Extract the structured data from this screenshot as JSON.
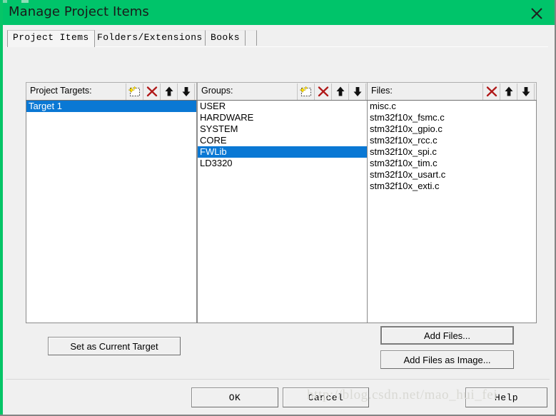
{
  "window": {
    "title": "Manage Project Items",
    "close_icon": "close-icon",
    "titlebar_color": "#00c46a",
    "accent_selection_color": "#0a78d4",
    "background_color": "#f0f0f0"
  },
  "tabs": [
    {
      "label": "Project Items",
      "active": true
    },
    {
      "label": "Folders/Extensions",
      "active": false
    },
    {
      "label": "Books",
      "active": false
    }
  ],
  "columns": {
    "project_targets": {
      "label": "Project Targets:",
      "buttons": [
        {
          "name": "new-item-icon",
          "title": "New (Insert)"
        },
        {
          "name": "delete-icon",
          "title": "Remove Item"
        },
        {
          "name": "arrow-up-icon",
          "title": "Move Up"
        },
        {
          "name": "arrow-down-icon",
          "title": "Move Down"
        }
      ],
      "items": [
        {
          "label": "Target 1",
          "selected": true
        }
      ]
    },
    "groups": {
      "label": "Groups:",
      "buttons": [
        {
          "name": "new-item-icon",
          "title": "New (Insert)"
        },
        {
          "name": "delete-icon",
          "title": "Remove Item"
        },
        {
          "name": "arrow-up-icon",
          "title": "Move Up"
        },
        {
          "name": "arrow-down-icon",
          "title": "Move Down"
        }
      ],
      "items": [
        {
          "label": "USER",
          "selected": false
        },
        {
          "label": "HARDWARE",
          "selected": false
        },
        {
          "label": "SYSTEM",
          "selected": false
        },
        {
          "label": "CORE",
          "selected": false
        },
        {
          "label": "FWLib",
          "selected": true
        },
        {
          "label": "LD3320",
          "selected": false
        }
      ]
    },
    "files": {
      "label": "Files:",
      "buttons": [
        {
          "name": "delete-icon",
          "title": "Remove Item"
        },
        {
          "name": "arrow-up-icon",
          "title": "Move Up"
        },
        {
          "name": "arrow-down-icon",
          "title": "Move Down"
        }
      ],
      "items": [
        {
          "label": "misc.c",
          "selected": false
        },
        {
          "label": "stm32f10x_fsmc.c",
          "selected": false
        },
        {
          "label": "stm32f10x_gpio.c",
          "selected": false
        },
        {
          "label": "stm32f10x_rcc.c",
          "selected": false
        },
        {
          "label": "stm32f10x_spi.c",
          "selected": false
        },
        {
          "label": "stm32f10x_tim.c",
          "selected": false
        },
        {
          "label": "stm32f10x_usart.c",
          "selected": false
        },
        {
          "label": "stm32f10x_exti.c",
          "selected": false
        }
      ]
    }
  },
  "actions": {
    "set_current_target": "Set as Current Target",
    "add_files": "Add Files...",
    "add_files_as_image": "Add Files as Image..."
  },
  "footer": {
    "ok": "OK",
    "cancel": "Cancel",
    "help": "Help"
  },
  "watermark": "http://blog.csdn.net/mao_hui_fei"
}
